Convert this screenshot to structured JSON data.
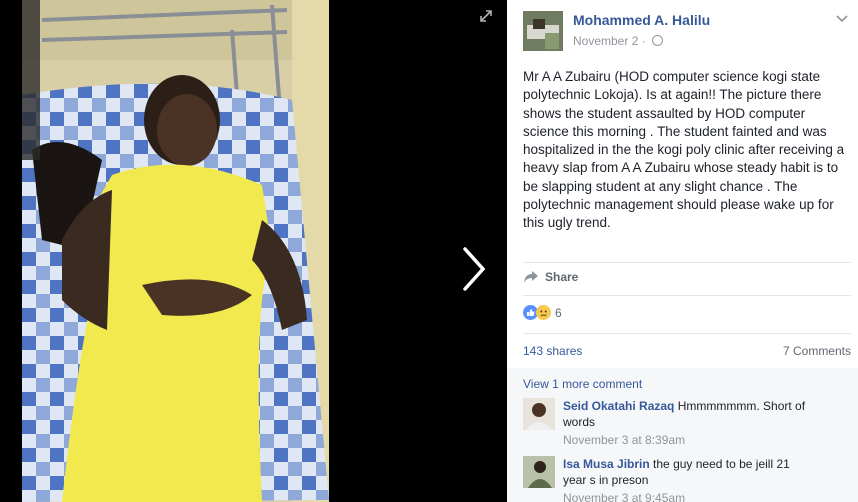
{
  "post": {
    "author": "Mohammed A. Halilu",
    "date": "November 2",
    "separator": "·",
    "text": "Mr A A Zubairu (HOD computer science kogi state polytechnic Lokoja). Is at again!! The picture there shows the student assaulted by HOD computer science this morning . The student fainted and was hospitalized in the the kogi poly clinic after receiving a heavy slap from A A Zubairu whose steady habit is to be slapping student at any slight chance . The polytechnic management should please wake up for this ugly trend."
  },
  "actions": {
    "share_label": "Share"
  },
  "stats": {
    "reactions_count": "6",
    "shares": "143 shares",
    "comments": "7 Comments"
  },
  "comments": {
    "view_more": "View 1 more comment",
    "items": [
      {
        "name": "Seid Okatahi Razaq",
        "text": "Hmmmmmmm. Short of words",
        "time": "November 3 at 8:39am"
      },
      {
        "name": "Isa Musa Jibrin",
        "text": "the guy need to be jeill 21 year s in preson",
        "time": "November 3 at 9:45am"
      }
    ]
  },
  "icons": {
    "expand": "expand-icon",
    "next": "chevron-right-icon",
    "audience": "globe-icon",
    "options": "chevron-down-icon",
    "share": "share-arrow-icon",
    "like": "like-reaction-icon",
    "sad": "sad-reaction-icon"
  },
  "colors": {
    "link": "#365899",
    "meta": "#90949c",
    "text": "#1d2129",
    "like": "#5890ff",
    "sad": "#f7c94c"
  }
}
